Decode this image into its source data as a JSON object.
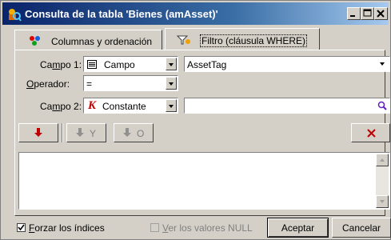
{
  "window": {
    "title": "Consulta de la tabla 'Bienes (amAsset)'"
  },
  "tabs": [
    {
      "label": "Columnas y ordenación"
    },
    {
      "label": "Filtro (cláusula WHERE)"
    }
  ],
  "campo1": {
    "label_pre": "Ca",
    "label_u": "m",
    "label_post": "po 1:",
    "type_value": "Campo",
    "field_value": "AssetTag"
  },
  "operador": {
    "label_u": "O",
    "label_post": "perador:",
    "value": "="
  },
  "campo2": {
    "label_pre": "Ca",
    "label_u": "m",
    "label_post": "po 2:",
    "type_value": "Constante",
    "field_value": ""
  },
  "toolbar": {
    "and_label": "Y",
    "or_label": "O"
  },
  "bottom": {
    "force_u": "F",
    "force_rest": "orzar los índices",
    "null_u": "V",
    "null_rest": "er los valores NULL",
    "accept_label": "Aceptar",
    "cancel_label": "Cancelar"
  }
}
